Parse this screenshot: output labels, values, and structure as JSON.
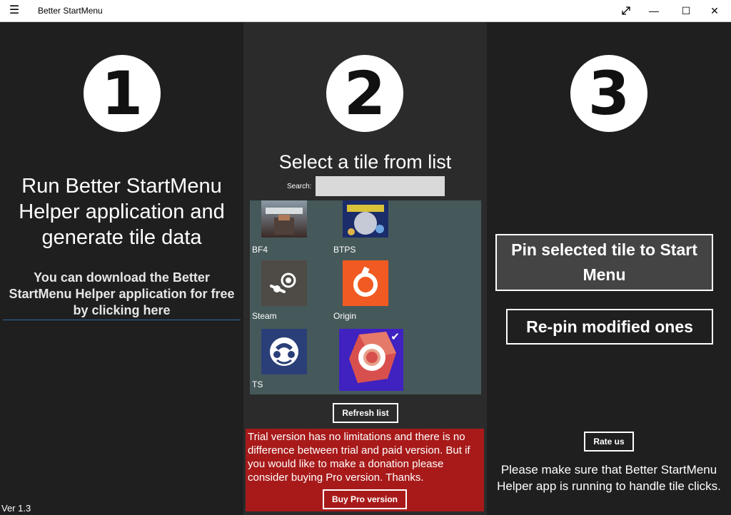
{
  "titlebar": {
    "menu_icon": "hamburger-icon",
    "title": "Better StartMenu",
    "controls": {
      "fullscreen_icon": "expand-icon",
      "minimize": "—",
      "maximize": "☐",
      "close": "✕"
    }
  },
  "step1": {
    "number": "1",
    "heading": "Run Better StartMenu Helper application and generate tile data",
    "download_link": "You can download the Better StartMenu Helper application for free by clicking here",
    "version": "Ver 1.3"
  },
  "step2": {
    "number": "2",
    "heading": "Select a tile from list",
    "search_label": "Search:",
    "search_value": "",
    "tiles": [
      {
        "label": "BF4",
        "icon": "battlefield-4-icon"
      },
      {
        "label": "BTPS",
        "icon": "borderlands-pre-sequel-icon"
      },
      {
        "label": "Steam",
        "icon": "steam-icon"
      },
      {
        "label": "Origin",
        "icon": "origin-icon"
      },
      {
        "label": "TS",
        "icon": "teamspeak-icon"
      },
      {
        "label": "",
        "icon": "chrome-canary-icon",
        "selected": true
      }
    ],
    "refresh_label": "Refresh list",
    "trial_text": "Trial version has no limitations and there is no difference between trial and paid version. But if you would like to make a donation please consider buying Pro version. Thanks.",
    "buy_label": "Buy Pro version"
  },
  "step3": {
    "number": "3",
    "pin_label": "Pin selected tile to Start Menu",
    "repin_label": "Re-pin modified ones",
    "rate_label": "Rate us",
    "note": "Please make sure that Better StartMenu Helper app is running to handle tile clicks."
  },
  "colors": {
    "col_dark": "#1f1f1f",
    "col_mid": "#2b2b2b",
    "tile_panel": "#46595a",
    "trial_bg": "#a81a1a",
    "selected_tile": "#3f22c0",
    "origin": "#f15a22",
    "link_underline": "#2f6aa5"
  }
}
